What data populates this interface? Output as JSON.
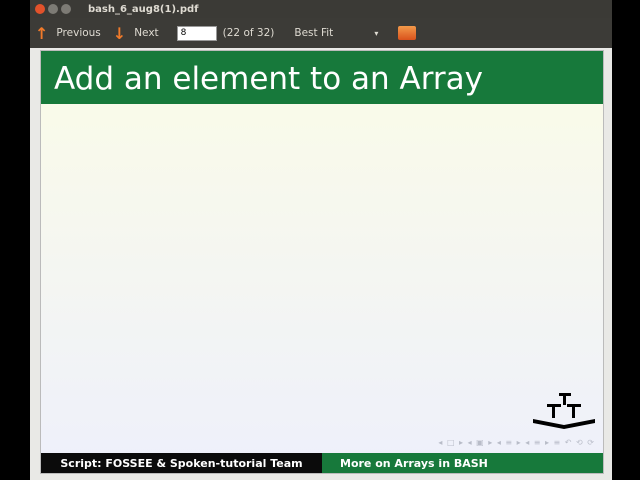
{
  "window": {
    "title": "bash_6_aug8(1).pdf"
  },
  "toolbar": {
    "previous_label": "Previous",
    "next_label": "Next",
    "page_value": "8",
    "page_count": "(22 of 32)",
    "zoom_value": "Best Fit",
    "dropdown_arrow": "▾"
  },
  "slide": {
    "title": "Add an element to an Array",
    "footer_left": "Script: FOSSEE & Spoken-tutorial Team",
    "footer_right": "More on Arrays in BASH",
    "nav_symbols": "◂ □ ▸ ◂ ▣ ▸ ◂ ≡ ▸ ◂ ≡ ▸   ≡   ↶ ⟲ ⟳"
  },
  "colors": {
    "green": "#17793b",
    "toolbar": "#3c3b37"
  }
}
